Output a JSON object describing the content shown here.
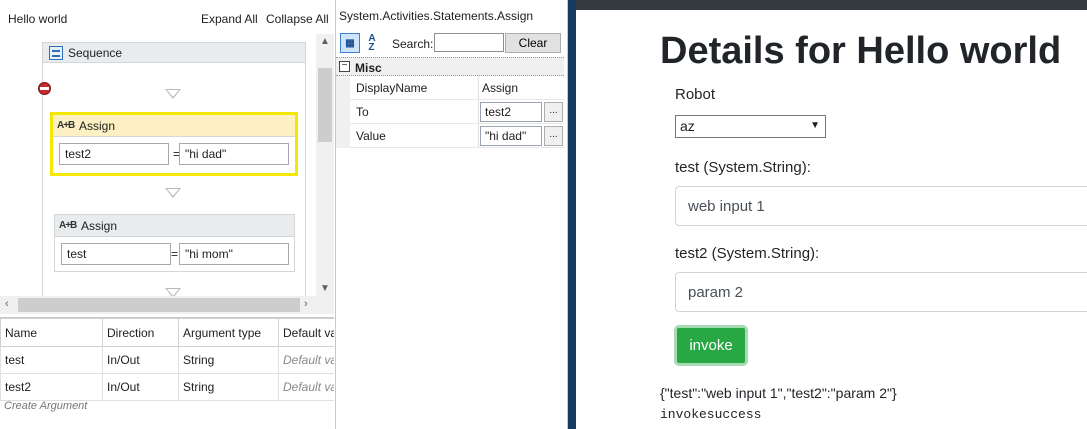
{
  "designer": {
    "title": "Hello world",
    "expand_all": "Expand All",
    "collapse_all": "Collapse All",
    "sequence": {
      "label": "Sequence",
      "icon": "sequence-icon"
    },
    "activities": [
      {
        "label": "Assign",
        "icon_text": "A+B",
        "to": "test2",
        "value": "\"hi dad\"",
        "selected": true
      },
      {
        "label": "Assign",
        "icon_text": "A+B",
        "to": "test",
        "value": "\"hi mom\"",
        "selected": false
      }
    ],
    "equals": "=",
    "selection_color": "#f5e800"
  },
  "arguments": {
    "columns": [
      "Name",
      "Direction",
      "Argument type",
      "Default va"
    ],
    "rows": [
      {
        "name": "test",
        "direction": "In/Out",
        "type": "String",
        "default": "Default va"
      },
      {
        "name": "test2",
        "direction": "In/Out",
        "type": "String",
        "default": "Default va"
      }
    ],
    "create": "Create Argument"
  },
  "properties": {
    "title": "System.Activities.Statements.Assign",
    "search_label": "Search:",
    "search_value": "",
    "clear": "Clear",
    "category": "Misc",
    "sort_text": "A\nZ",
    "rows": [
      {
        "name": "DisplayName",
        "value": "Assign"
      },
      {
        "name": "To",
        "value": "test2"
      },
      {
        "name": "Value",
        "value": "\"hi dad\""
      }
    ],
    "ellipsis": "..."
  },
  "webapp": {
    "title": "Details for Hello world",
    "robot_label": "Robot",
    "robot_value": "az",
    "test_label": "test (System.String):",
    "test_value": "web input 1",
    "test2_label": "test2 (System.String):",
    "test2_value": "param 2",
    "invoke": "invoke",
    "result_json": "{\"test\":\"web input 1\",\"test2\":\"param 2\"}",
    "result_status": "invokesuccess",
    "accent_color": "#28a745"
  }
}
